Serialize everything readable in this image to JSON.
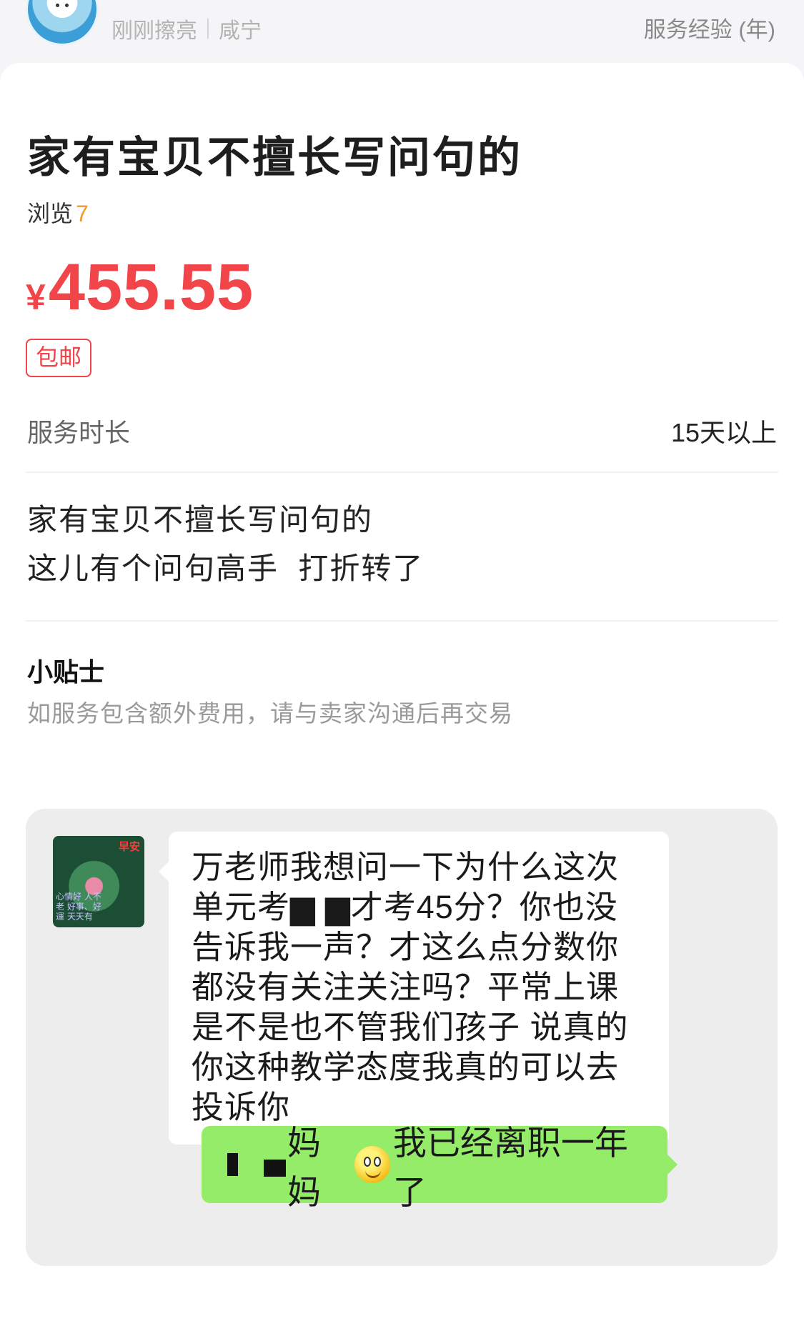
{
  "header": {
    "status": "刚刚擦亮",
    "location": "咸宁",
    "experience_label": "服务经验 (年)"
  },
  "listing": {
    "title": "家有宝贝不擅长写问句的",
    "views_label": "浏览",
    "views_count": "7",
    "currency": "¥",
    "price": "455.55",
    "shipping_badge": "包邮",
    "duration_label": "服务时长",
    "duration_value": "15天以上",
    "description_lines": [
      "家有宝贝不擅长写问句的",
      "这儿有个问句高手  打折转了"
    ]
  },
  "tips": {
    "title": "小贴士",
    "text": "如服务包含额外费用，请与卖家沟通后再交易"
  },
  "chat": {
    "avatar_tag": "早安",
    "avatar_text": "心情好 人不老 好事、好運 天天有",
    "incoming_message": "万老师我想问一下为什么这次单元考▆ ▆才考45分？你也没告诉我一声？才这么点分数你都没有关注关注吗？平常上课是不是也不管我们孩子 说真的你这种教学态度我真的可以去投诉你",
    "outgoing_before": "妈妈",
    "outgoing_after": "我已经离职一年了"
  },
  "colors": {
    "price": "#f2454a",
    "views_count": "#f29b2d",
    "outgoing_bubble": "#95ec69"
  }
}
